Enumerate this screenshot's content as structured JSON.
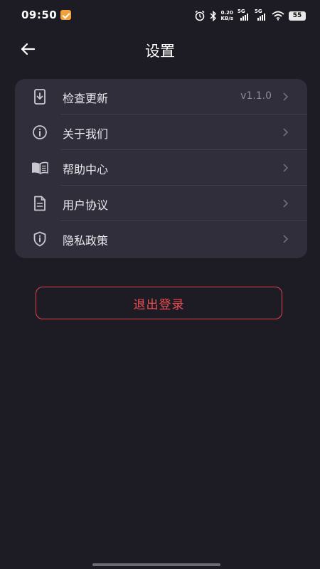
{
  "status_bar": {
    "time": "09:50",
    "net_speed_value": "0.20",
    "net_speed_unit": "KB/s",
    "sim1_label": "5G",
    "sim2_label": "5G",
    "battery_level": "55"
  },
  "header": {
    "title": "设置"
  },
  "menu": {
    "items": [
      {
        "label": "检查更新",
        "value": "v1.1.0",
        "icon": "download-icon"
      },
      {
        "label": "关于我们",
        "value": "",
        "icon": "info-icon"
      },
      {
        "label": "帮助中心",
        "value": "",
        "icon": "book-icon"
      },
      {
        "label": "用户协议",
        "value": "",
        "icon": "document-icon"
      },
      {
        "label": "隐私政策",
        "value": "",
        "icon": "shield-icon"
      }
    ]
  },
  "logout": {
    "label": "退出登录"
  },
  "colors": {
    "background": "#1d1c25",
    "card": "#2f2e3a",
    "accent_red": "#e0474b"
  }
}
